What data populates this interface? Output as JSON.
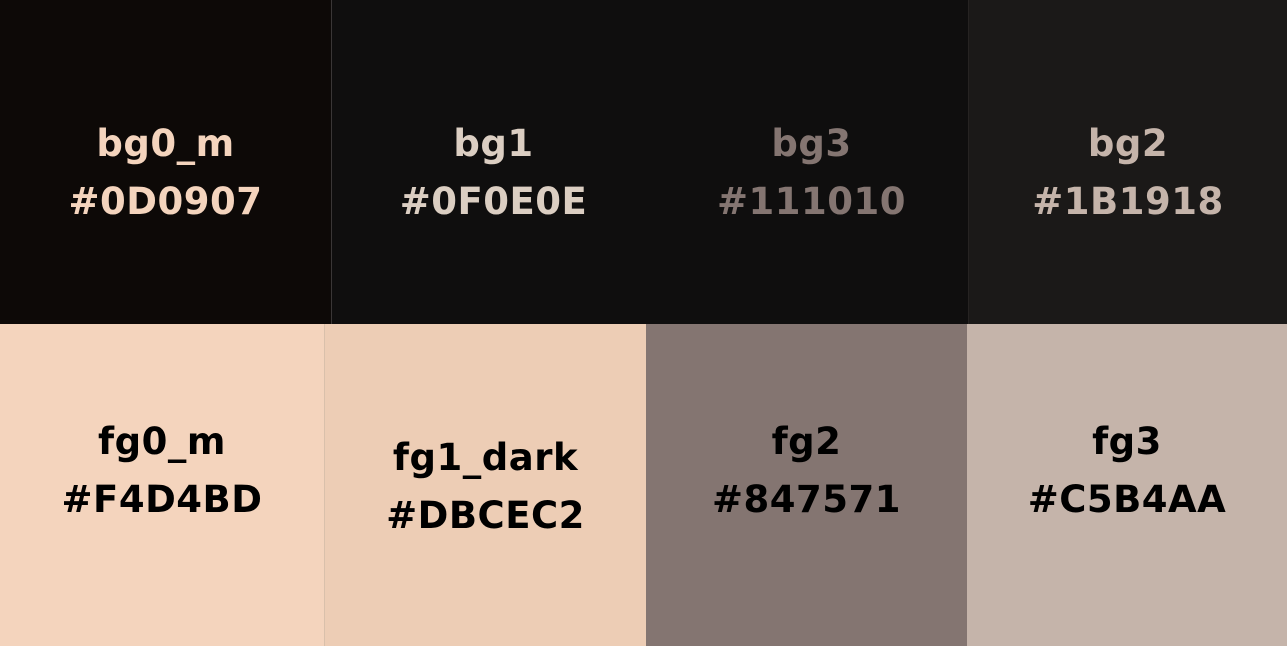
{
  "swatches": [
    {
      "name": "bg0_m",
      "hex": "#0D0907",
      "background": "#0D0907",
      "text_color": "#F4D4BD"
    },
    {
      "name": "bg1",
      "hex": "#0F0E0E",
      "background": "#0F0E0E",
      "text_color": "#DBCEC2"
    },
    {
      "name": "bg3",
      "hex": "#111010",
      "background": "#0F0E0E",
      "text_color": "#847571"
    },
    {
      "name": "bg2",
      "hex": "#1B1918",
      "background": "#1B1918",
      "text_color": "#C5B4AA"
    },
    {
      "name": "fg0_m",
      "hex": "#F4D4BD",
      "background": "#F4D4BD",
      "text_color": "#000000"
    },
    {
      "name": "fg1_dark",
      "hex": "#DBCEC2",
      "background": "#EDCDB5",
      "text_color": "#000000"
    },
    {
      "name": "fg2",
      "hex": "#847571",
      "background": "#847571",
      "text_color": "#000000"
    },
    {
      "name": "fg3",
      "hex": "#C5B4AA",
      "background": "#C5B4AA",
      "text_color": "#000000"
    }
  ]
}
